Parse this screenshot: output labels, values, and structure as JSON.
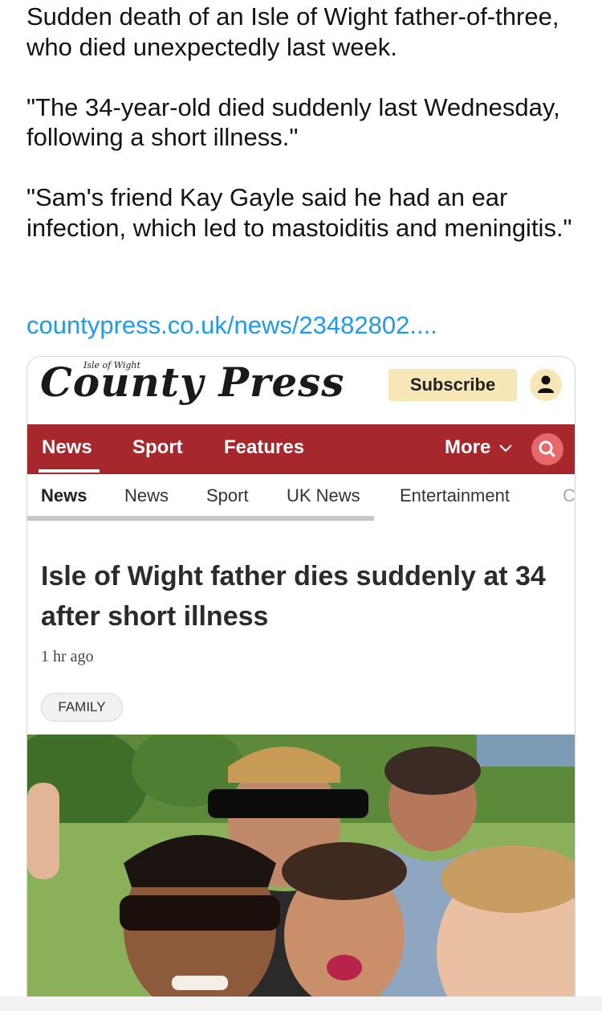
{
  "tweet": {
    "para1": "Sudden death of an Isle of Wight father-of-three, who died unexpectedly last week.",
    "para2": "\"The 34-year-old died suddenly last Wednesday, following a short illness.\"",
    "para3": "\"Sam's friend Kay Gayle said he had an ear infection, which led to mastoiditis and meningitis.\"",
    "link": "countypress.co.uk/news/23482802...."
  },
  "card": {
    "logo_small": "Isle of Wight",
    "logo_main": "County Press",
    "subscribe_label": "Subscribe",
    "main_nav": [
      {
        "label": "News"
      },
      {
        "label": "Sport"
      },
      {
        "label": "Features"
      },
      {
        "label": "More"
      }
    ],
    "sub_nav": [
      {
        "label": "News"
      },
      {
        "label": "News"
      },
      {
        "label": "Sport"
      },
      {
        "label": "UK News"
      },
      {
        "label": "Entertainment"
      },
      {
        "label": "C"
      }
    ],
    "headline": "Isle of Wight father dies suddenly at 34 after short illness",
    "time": "1 hr ago",
    "tag": "FAMILY"
  },
  "colors": {
    "nav_red": "#a6282d",
    "subscribe_bg": "#f7e6b6",
    "link_blue": "#1d9bf0"
  }
}
